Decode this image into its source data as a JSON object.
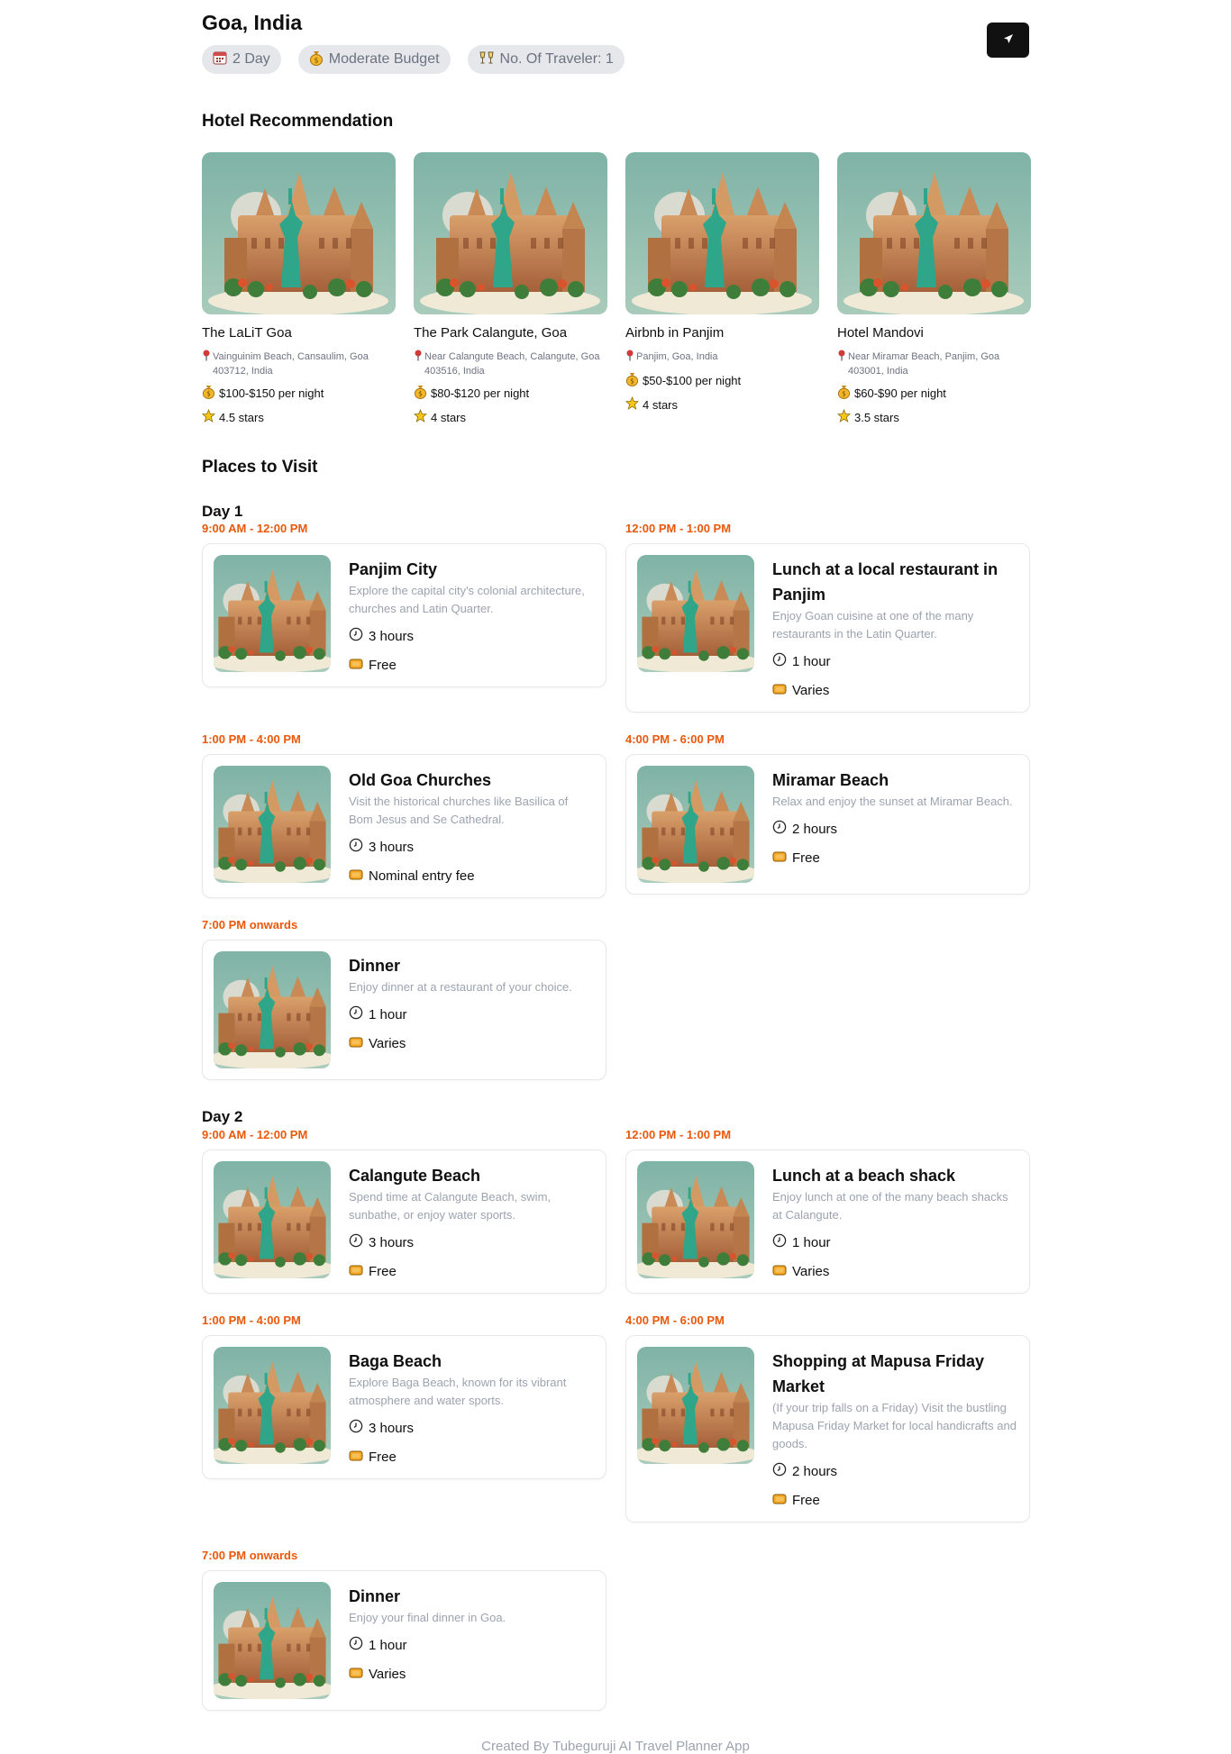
{
  "trip": {
    "destination": "Goa, India",
    "chips": [
      {
        "icon": "calendar-icon",
        "label": "2 Day"
      },
      {
        "icon": "money-bag-icon",
        "label": "Moderate Budget"
      },
      {
        "icon": "cheers-icon",
        "label": "No. Of Traveler: 1"
      }
    ]
  },
  "sections": {
    "hotels_title": "Hotel Recommendation",
    "places_title": "Places to Visit"
  },
  "hotels": [
    {
      "name": "The LaLiT Goa",
      "address": "Vainguinim Beach, Cansaulim, Goa 403712, India",
      "price": "$100-$150 per night",
      "rating": "4.5 stars"
    },
    {
      "name": "The Park Calangute, Goa",
      "address": "Near Calangute Beach, Calangute, Goa 403516, India",
      "price": "$80-$120 per night",
      "rating": "4 stars"
    },
    {
      "name": "Airbnb in Panjim",
      "address": "Panjim, Goa, India",
      "price": "$50-$100 per night",
      "rating": "4 stars"
    },
    {
      "name": "Hotel Mandovi",
      "address": "Near Miramar Beach, Panjim, Goa 403001, India",
      "price": "$60-$90 per night",
      "rating": "3.5 stars"
    }
  ],
  "days": [
    {
      "label": "Day 1",
      "places": [
        {
          "time": "9:00 AM - 12:00 PM",
          "title": "Panjim City",
          "desc": "Explore the capital city's colonial architecture, churches and Latin Quarter.",
          "duration": "3 hours",
          "cost": "Free"
        },
        {
          "time": "12:00 PM - 1:00 PM",
          "title": "Lunch at a local restaurant in Panjim",
          "desc": "Enjoy Goan cuisine at one of the many restaurants in the Latin Quarter.",
          "duration": "1 hour",
          "cost": "Varies"
        },
        {
          "time": "1:00 PM - 4:00 PM",
          "title": "Old Goa Churches",
          "desc": "Visit the historical churches like Basilica of Bom Jesus and Se Cathedral.",
          "duration": "3 hours",
          "cost": "Nominal entry fee"
        },
        {
          "time": "4:00 PM - 6:00 PM",
          "title": "Miramar Beach",
          "desc": "Relax and enjoy the sunset at Miramar Beach.",
          "duration": "2 hours",
          "cost": "Free"
        },
        {
          "time": "7:00 PM onwards",
          "title": "Dinner",
          "desc": "Enjoy dinner at a restaurant of your choice.",
          "duration": "1 hour",
          "cost": "Varies"
        }
      ]
    },
    {
      "label": "Day 2",
      "places": [
        {
          "time": "9:00 AM - 12:00 PM",
          "title": "Calangute Beach",
          "desc": "Spend time at Calangute Beach, swim, sunbathe, or enjoy water sports.",
          "duration": "3 hours",
          "cost": "Free"
        },
        {
          "time": "12:00 PM - 1:00 PM",
          "title": "Lunch at a beach shack",
          "desc": "Enjoy lunch at one of the many beach shacks at Calangute.",
          "duration": "1 hour",
          "cost": "Varies"
        },
        {
          "time": "1:00 PM - 4:00 PM",
          "title": "Baga Beach",
          "desc": "Explore Baga Beach, known for its vibrant atmosphere and water sports.",
          "duration": "3 hours",
          "cost": "Free"
        },
        {
          "time": "4:00 PM - 6:00 PM",
          "title": "Shopping at Mapusa Friday Market",
          "desc": "(If your trip falls on a Friday) Visit the bustling Mapusa Friday Market for local handicrafts and goods.",
          "duration": "2 hours",
          "cost": "Free"
        },
        {
          "time": "7:00 PM onwards",
          "title": "Dinner",
          "desc": "Enjoy your final dinner in Goa.",
          "duration": "1 hour",
          "cost": "Varies"
        }
      ]
    }
  ],
  "footer": "Created By Tubeguruji AI Travel Planner App",
  "colors": {
    "accent_time": "#ea580c",
    "muted": "#9ca3af",
    "button_dark": "#111111",
    "chip_bg": "#e5e7eb"
  }
}
